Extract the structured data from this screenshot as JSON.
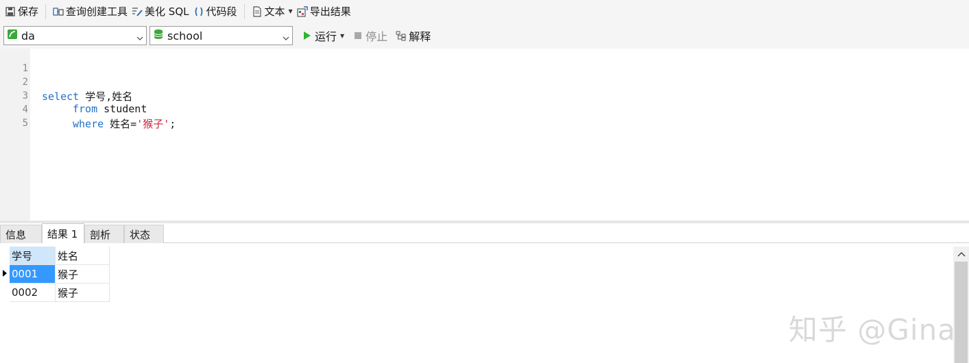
{
  "toolbar": {
    "save": "保存",
    "query_builder": "查询创建工具",
    "beautify_sql": "美化 SQL",
    "code_snippet": "代码段",
    "text": "文本",
    "export_results": "导出结果"
  },
  "connection": {
    "selected": "da"
  },
  "database": {
    "selected": "school"
  },
  "run_controls": {
    "run": "运行",
    "stop": "停止",
    "explain": "解释"
  },
  "editor": {
    "line_numbers": [
      "1",
      "2",
      "3",
      "4",
      "5"
    ],
    "lines": [
      {
        "kw": "",
        "rest": "",
        "str": "",
        "end": ""
      },
      {
        "kw": "select",
        "rest": " 学号,姓名",
        "str": "",
        "end": ""
      },
      {
        "kw": "from",
        "rest": " student",
        "str": "",
        "end": ""
      },
      {
        "kw": "where",
        "rest": " 姓名=",
        "str": "'猴子'",
        "end": ";"
      },
      {
        "kw": "",
        "rest": "",
        "str": "",
        "end": ""
      }
    ]
  },
  "result_tabs": [
    "信息",
    "结果 1",
    "剖析",
    "状态"
  ],
  "active_tab": "结果 1",
  "result_grid": {
    "columns": [
      "学号",
      "姓名"
    ],
    "rows": [
      [
        "0001",
        "猴子"
      ],
      [
        "0002",
        "猴子"
      ]
    ]
  },
  "watermark": "知乎 @Gina",
  "colors": {
    "keyword": "#1f6fc9",
    "string": "#c8283c",
    "selection": "#3399ff",
    "run_icon": "#2db52d"
  }
}
